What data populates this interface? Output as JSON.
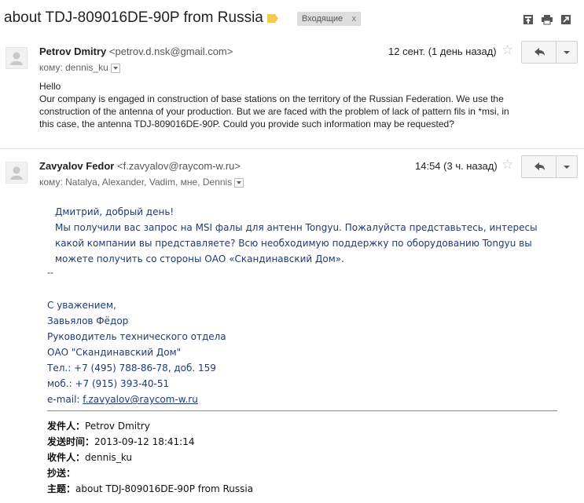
{
  "subject": "about TDJ-809016DE-90P from Russia",
  "inbox_label": "Входящие",
  "inbox_remove": "x",
  "msg1": {
    "sender_name": "Petrov Dmitry",
    "sender_email": "<petrov.d.nsk@gmail.com>",
    "to": "кому: dennis_ku",
    "date": "12 сент. (1 день назад)",
    "star": "☆",
    "body": [
      "Hello",
      "Our company is engaged in construction of base stations on the territory of the Russian Federation. We use the",
      "construction of the antenna of your production. But we are faced with the problem of lack of pattern fils in *msi, in",
      "this case, the antenna TDJ-809016DE-90P. Could you provide such information may be requested?"
    ]
  },
  "msg2": {
    "sender_name": "Zavyalov Fedor",
    "sender_email": "<f.zavyalov@raycom-w.ru>",
    "to": "кому: Natalya, Alexander, Vadim, мне, Dennis",
    "date": "14:54 (3 ч. назад)",
    "star": "☆",
    "body_ru": [
      "Дмитрий, добрый день!",
      "Мы получили вас запрос на MSI фалы для антенн Tongyu. Пожалуйста представьтесь, интересы",
      "какой компании вы представляете? Всю необходимую поддержку по оборудованию Tongyu вы",
      "можете получить со стороны ОАО «Скандинавский Дом»."
    ],
    "dashes": "--",
    "signature": [
      "С уважением,",
      "Завьялов Фёдор",
      "Руководитель технического отдела",
      "ОАО \"Скандинавский Дом\"",
      "Тел.: +7 (495) 788-86-78, доб. 159",
      "моб.: +7 (915) 393-40-51"
    ],
    "email_label": "e-mail: ",
    "email_link": "f.zavyalov@raycom-w.ru",
    "quoted_header": {
      "from_label": "发件人：",
      "from_value": "Petrov Dmitry",
      "sent_label": "发送时间：",
      "sent_value": "2013-09-12 18:41:14",
      "to_label": "收件人：",
      "to_value": "dennis_ku",
      "cc_label": "抄送：",
      "subject_label": "主题：",
      "subject_value": "about TDJ-809016DE-90P from Russia"
    }
  },
  "icons": {
    "label_tag": "label-tag-icon",
    "archive": "archive-icon",
    "print": "print-icon",
    "new_window": "new-window-icon",
    "avatar": "avatar-icon",
    "reply": "reply-icon"
  },
  "colors": {
    "label_tag": "#f2c94c",
    "link": "#1f3b73"
  }
}
